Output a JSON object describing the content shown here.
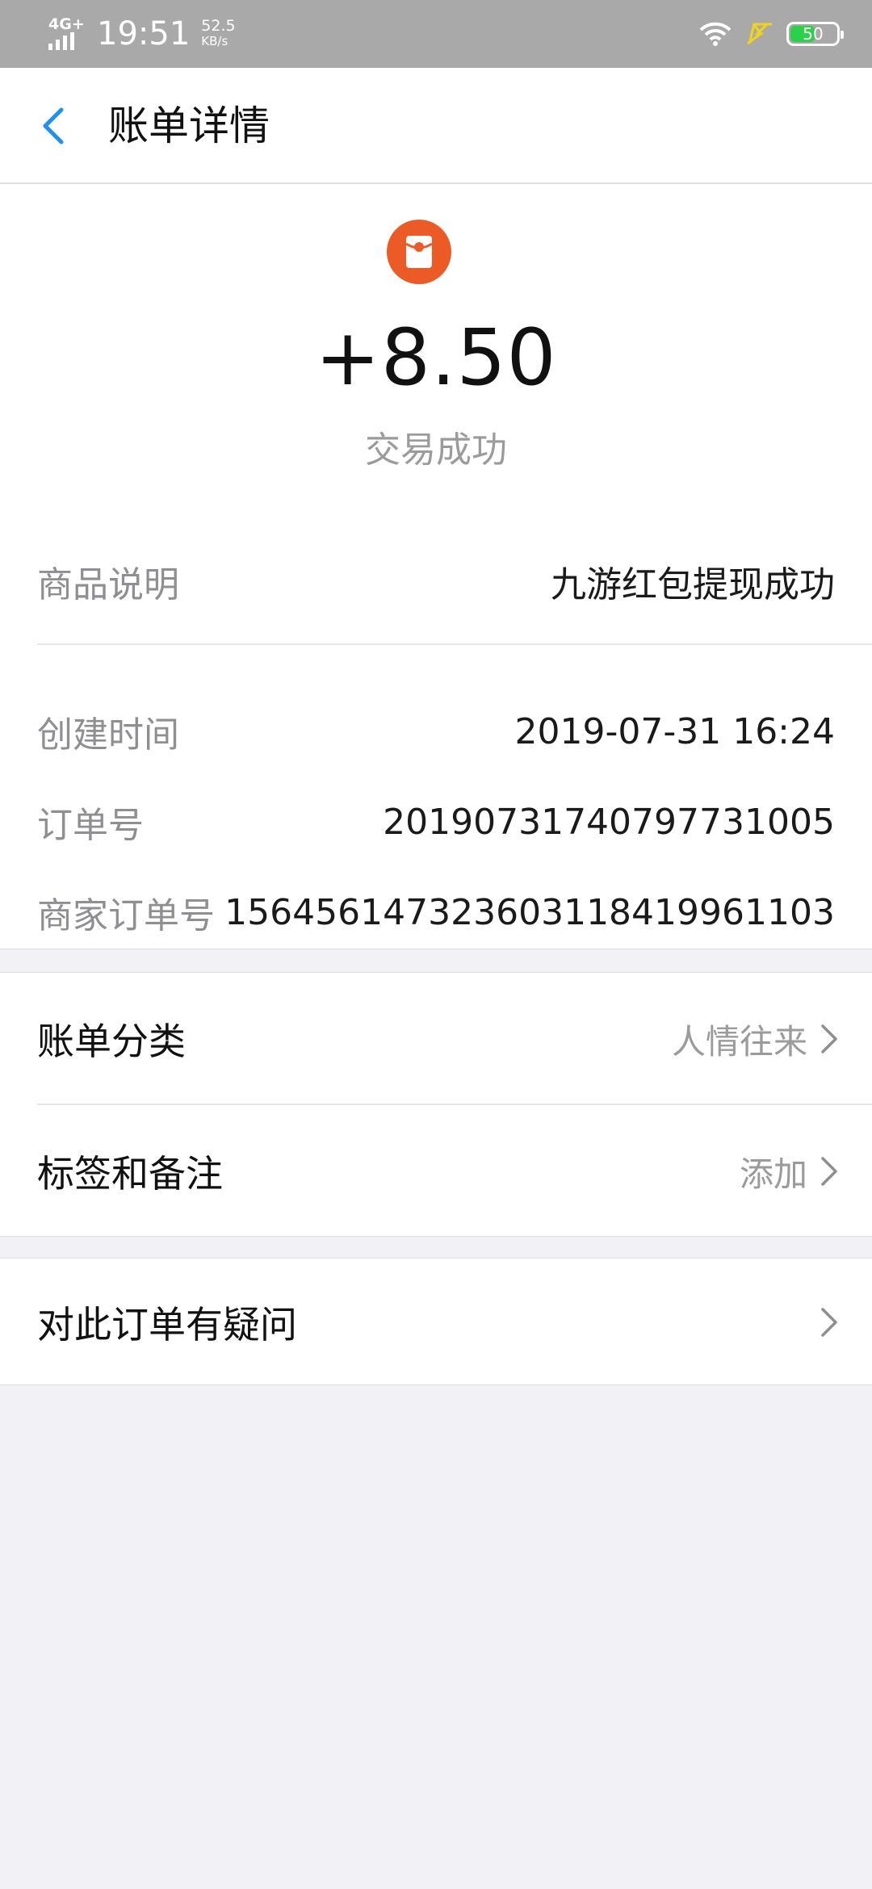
{
  "status_bar": {
    "network": "4G+",
    "time": "19:51",
    "speed_value": "52.5",
    "speed_unit": "KB/s",
    "battery": "50",
    "icons": [
      "signal-icon",
      "wifi-icon",
      "charging-icon",
      "battery-icon"
    ]
  },
  "nav": {
    "title": "账单详情",
    "back_icon": "chevron-left-icon"
  },
  "hero": {
    "icon": "red-envelope-icon",
    "amount": "+8.50",
    "status": "交易成功"
  },
  "details": {
    "product": {
      "label": "商品说明",
      "value": "九游红包提现成功"
    },
    "created": {
      "label": "创建时间",
      "value": "2019-07-31 16:24"
    },
    "order_no": {
      "label": "订单号",
      "value": "20190731740797731005"
    },
    "merchant_order_no": {
      "label": "商家订单号",
      "value": "156456147323603118419961103"
    }
  },
  "settings": {
    "category": {
      "label": "账单分类",
      "value": "人情往来"
    },
    "tags": {
      "label": "标签和备注",
      "value": "添加"
    }
  },
  "support": {
    "label": "对此订单有疑问"
  },
  "colors": {
    "accent": "#1d8ff5",
    "icon_orange": "#ec5a25",
    "page_bg": "#f2f2f6",
    "status_bar": "#a9a9a9"
  }
}
